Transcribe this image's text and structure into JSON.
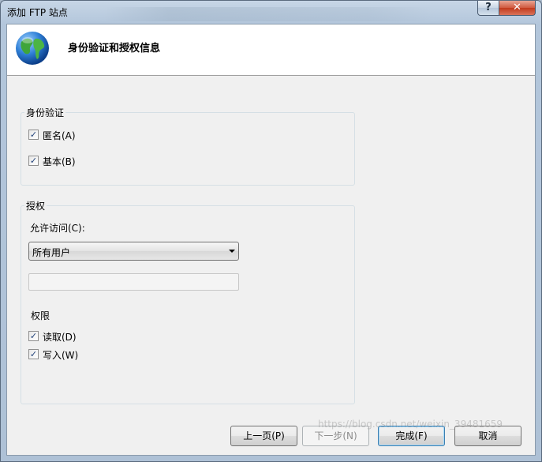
{
  "window": {
    "title": "添加 FTP 站点",
    "help_label": "?",
    "close_label": "✕"
  },
  "header": {
    "title": "身份验证和授权信息",
    "icon": "globe-icon"
  },
  "auth_group": {
    "label": "身份验证",
    "anonymous": {
      "label": "匿名(A)",
      "checked": true
    },
    "basic": {
      "label": "基本(B)",
      "checked": true
    }
  },
  "authz_group": {
    "label": "授权",
    "allow_access_label": "允许访问(C):",
    "allow_access_value": "所有用户",
    "textbox_value": "",
    "permissions_label": "权限",
    "read": {
      "label": "读取(D)",
      "checked": true
    },
    "write": {
      "label": "写入(W)",
      "checked": true
    }
  },
  "buttons": {
    "prev": "上一页(P)",
    "next": "下一步(N)",
    "finish": "完成(F)",
    "cancel": "取消"
  },
  "watermark": "https://blog.csdn.net/weixin_39481659",
  "colors": {
    "title_bar": "#b3c6db",
    "client_bg": "#f0f0f0",
    "check_mark": "#21427a"
  }
}
